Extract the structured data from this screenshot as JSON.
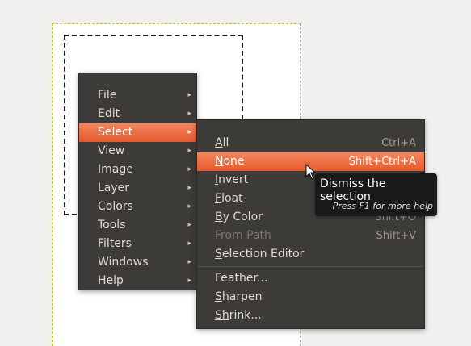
{
  "main_menu": {
    "items": [
      {
        "label": "File"
      },
      {
        "label": "Edit"
      },
      {
        "label": "Select"
      },
      {
        "label": "View"
      },
      {
        "label": "Image"
      },
      {
        "label": "Layer"
      },
      {
        "label": "Colors"
      },
      {
        "label": "Tools"
      },
      {
        "label": "Filters"
      },
      {
        "label": "Windows"
      },
      {
        "label": "Help"
      }
    ],
    "active_item": "Select",
    "arrow_icon": "▸"
  },
  "select_submenu": {
    "items": [
      {
        "label": "All",
        "mnemonic": "A",
        "rest": "ll",
        "shortcut": "Ctrl+A"
      },
      {
        "label": "None",
        "mnemonic": "N",
        "rest": "one",
        "shortcut": "Shift+Ctrl+A"
      },
      {
        "label": "Invert",
        "mnemonic": "I",
        "rest": "nvert",
        "shortcut": ""
      },
      {
        "label": "Float",
        "mnemonic": "F",
        "rest": "loat",
        "shortcut": ""
      },
      {
        "label": "By Color",
        "mnemonic": "B",
        "rest": "y Color",
        "shortcut": "Shift+O"
      },
      {
        "label": "From Path",
        "mnemonic": "",
        "rest": "From Path",
        "shortcut": "Shift+V"
      },
      {
        "label": "Selection Editor",
        "mnemonic": "S",
        "rest": "election Editor",
        "shortcut": ""
      },
      {
        "label": "Feather...",
        "mnemonic": "",
        "rest": "Feather...",
        "shortcut": ""
      },
      {
        "label": "Sharpen",
        "mnemonic": "S",
        "rest": "harpen",
        "shortcut": ""
      },
      {
        "label": "Shrink...",
        "mnemonic": "Sh",
        "rest": "rink...",
        "shortcut": ""
      }
    ],
    "active_item": "None"
  },
  "tooltip": {
    "title": "Dismiss the selection",
    "help": "Press F1 for more help"
  },
  "colors": {
    "menu_bg": "#3c3b37",
    "highlight": "#e96e44",
    "menu_text": "#dfdbd2",
    "tooltip_bg": "#191919"
  }
}
